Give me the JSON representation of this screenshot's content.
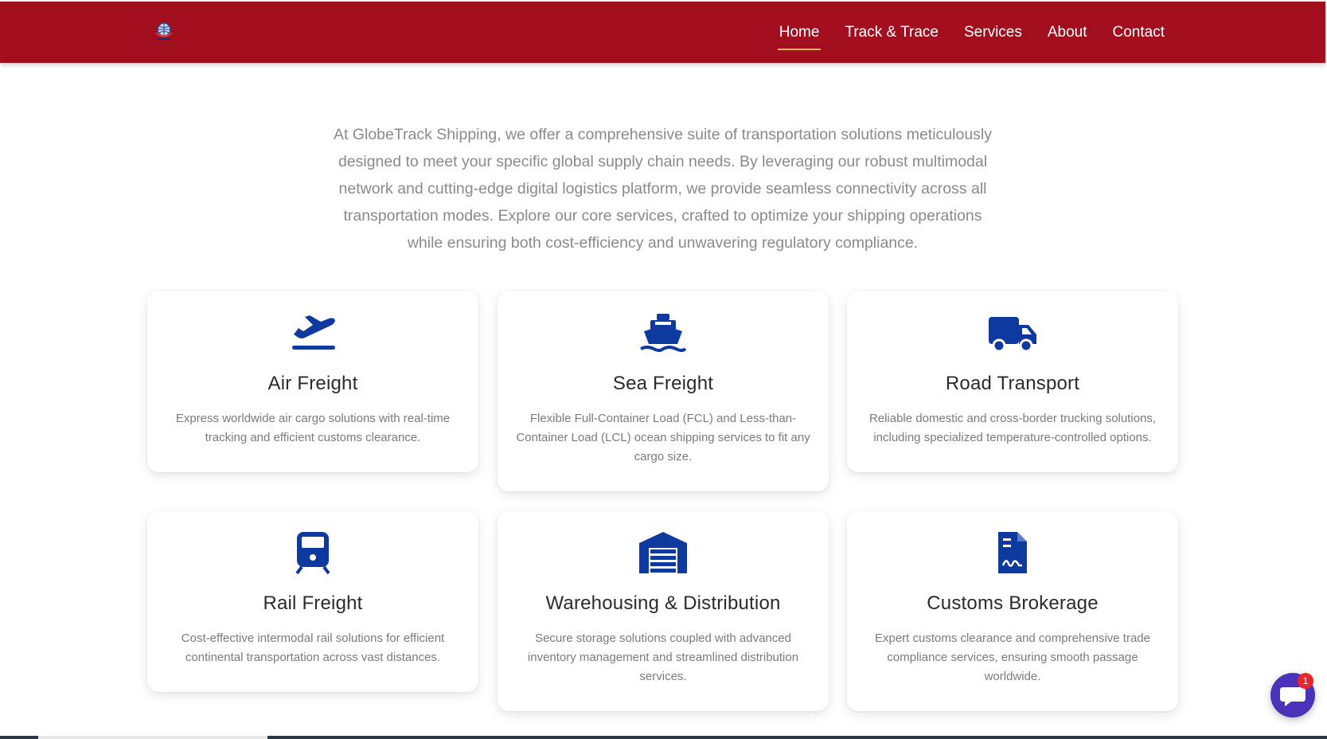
{
  "nav": {
    "logo_icon": "globe-logo-icon",
    "links": [
      {
        "label": "Home",
        "active": true
      },
      {
        "label": "Track & Trace",
        "active": false
      },
      {
        "label": "Services",
        "active": false
      },
      {
        "label": "About",
        "active": false
      },
      {
        "label": "Contact",
        "active": false
      }
    ]
  },
  "intro": {
    "text": "At GlobeTrack Shipping, we offer a comprehensive suite of transportation solutions meticulously designed to meet your specific global supply chain needs. By leveraging our robust multimodal network and cutting-edge digital logistics platform, we provide seamless connectivity across all transportation modes. Explore our core services, crafted to optimize your shipping operations while ensuring both cost-efficiency and unwavering regulatory compliance."
  },
  "services": [
    {
      "icon": "plane-departure-icon",
      "title": "Air Freight",
      "desc": "Express worldwide air cargo solutions with real-time tracking and efficient customs clearance."
    },
    {
      "icon": "ship-icon",
      "title": "Sea Freight",
      "desc": "Flexible Full-Container Load (FCL) and Less-than-Container Load (LCL) ocean shipping services to fit any cargo size."
    },
    {
      "icon": "truck-icon",
      "title": "Road Transport",
      "desc": "Reliable domestic and cross-border trucking solutions, including specialized temperature-controlled options."
    },
    {
      "icon": "train-icon",
      "title": "Rail Freight",
      "desc": "Cost-effective intermodal rail solutions for efficient continental transportation across vast distances."
    },
    {
      "icon": "warehouse-icon",
      "title": "Warehousing & Distribution",
      "desc": "Secure storage solutions coupled with advanced inventory management and streamlined distribution services."
    },
    {
      "icon": "file-signature-icon",
      "title": "Customs Brokerage",
      "desc": "Expert customs clearance and comprehensive trade compliance services, ensuring smooth passage worldwide."
    }
  ],
  "chat": {
    "icon": "chat-bubble-icon",
    "badge": "1"
  },
  "colors": {
    "brand_red": "#a10e1d",
    "icon_blue": "#0e3aa0",
    "chat_purple": "#4a33b8"
  }
}
